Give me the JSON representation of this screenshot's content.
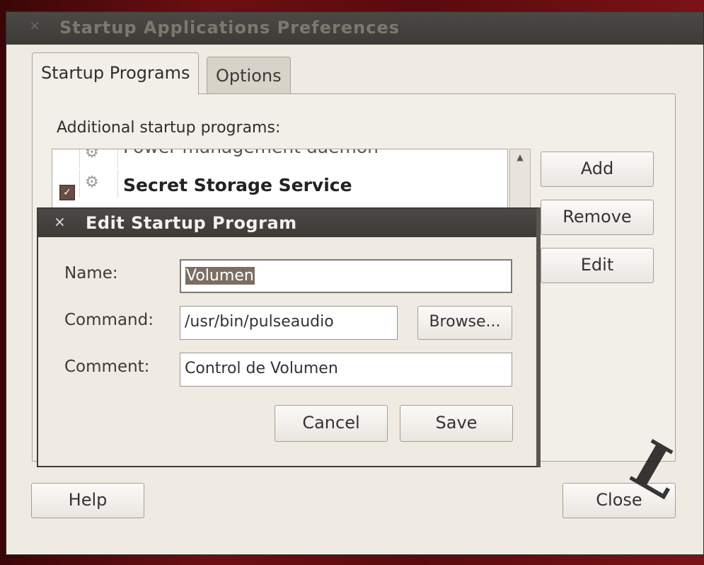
{
  "window": {
    "title": "Startup Applications Preferences",
    "close_glyph": "×"
  },
  "tabs": [
    {
      "label": "Startup Programs",
      "active": true
    },
    {
      "label": "Options",
      "active": false
    }
  ],
  "startup_programs": {
    "section_label": "Additional startup programs:",
    "items": [
      {
        "label": "Power management daemon",
        "checked": false,
        "icon": "gear-icon"
      },
      {
        "label": "Secret Storage Service",
        "checked": true,
        "icon": "gear-icon"
      }
    ],
    "buttons": {
      "add": "Add",
      "remove": "Remove",
      "edit": "Edit"
    }
  },
  "footer": {
    "help": "Help",
    "close": "Close"
  },
  "dialog": {
    "title": "Edit Startup Program",
    "close_glyph": "×",
    "name_label": "Name:",
    "name_value": "Volumen",
    "command_label": "Command:",
    "command_value": "/usr/bin/pulseaudio",
    "browse_label": "Browse...",
    "comment_label": "Comment:",
    "comment_value": "Control de Volumen",
    "cancel_label": "Cancel",
    "save_label": "Save"
  },
  "colors": {
    "titlebar": "#3c3b37",
    "window_bg": "#f0ebe2",
    "selection": "#7a6f63",
    "checkbox": "#6a4a44",
    "desktop": "#6d0f12"
  },
  "watermark_glyph": "L"
}
